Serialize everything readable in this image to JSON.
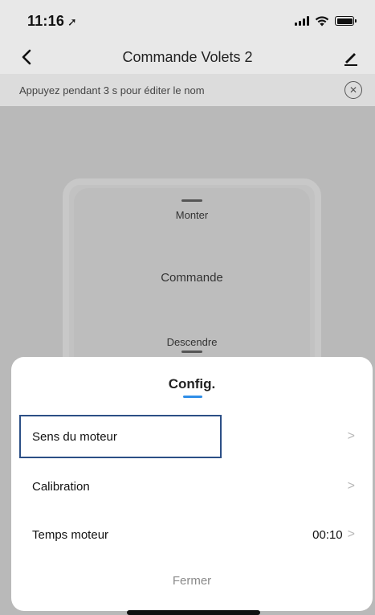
{
  "status_bar": {
    "time": "11:16",
    "location_icon": "location-arrow-icon",
    "icons": [
      "cellular-signal-icon",
      "wifi-icon",
      "battery-icon"
    ]
  },
  "nav": {
    "back_icon": "chevron-left-icon",
    "title": "Commande Volets 2",
    "edit_icon": "pencil-icon"
  },
  "hint": {
    "text": "Appuyez pendant 3 s pour éditer le nom",
    "close_icon": "close-circle-icon"
  },
  "control": {
    "up_label": "Monter",
    "center_label": "Commande",
    "down_label": "Descendre"
  },
  "sheet": {
    "title": "Config.",
    "rows": [
      {
        "label": "Sens du moteur",
        "value": ""
      },
      {
        "label": "Calibration",
        "value": ""
      },
      {
        "label": "Temps moteur",
        "value": "00:10"
      }
    ],
    "chevron": ">",
    "close_label": "Fermer"
  },
  "colors": {
    "accent": "#2f8ee8",
    "highlight": "#2c4f86",
    "overlay": "#b9b9b9"
  }
}
